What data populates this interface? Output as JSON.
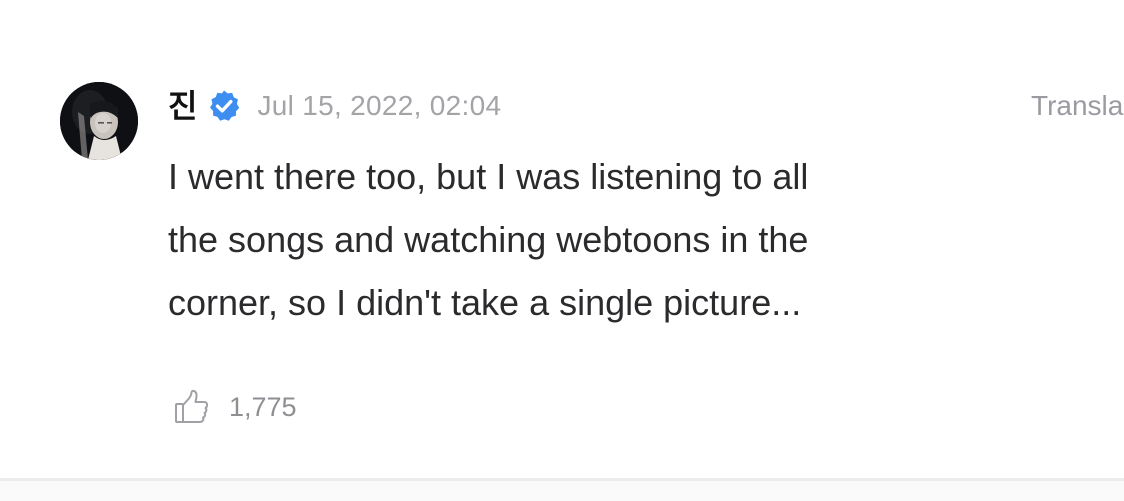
{
  "comment": {
    "author": {
      "name": "진",
      "verified": true,
      "avatar": "profile-photo"
    },
    "timestamp": "Jul 15, 2022, 02:04",
    "translate_label": "Transla",
    "text_lines": [
      "I went there too, but I was listening to all",
      "the songs and watching webtoons in the",
      "corner, so I didn't take a single picture..."
    ],
    "likes": {
      "icon": "thumbs-up-icon",
      "count": "1,775"
    }
  },
  "colors": {
    "verified_badge": "#3d8ef0",
    "timestamp": "#a4a4a8",
    "body_text": "#2b2b2e",
    "divider": "#ececee"
  }
}
